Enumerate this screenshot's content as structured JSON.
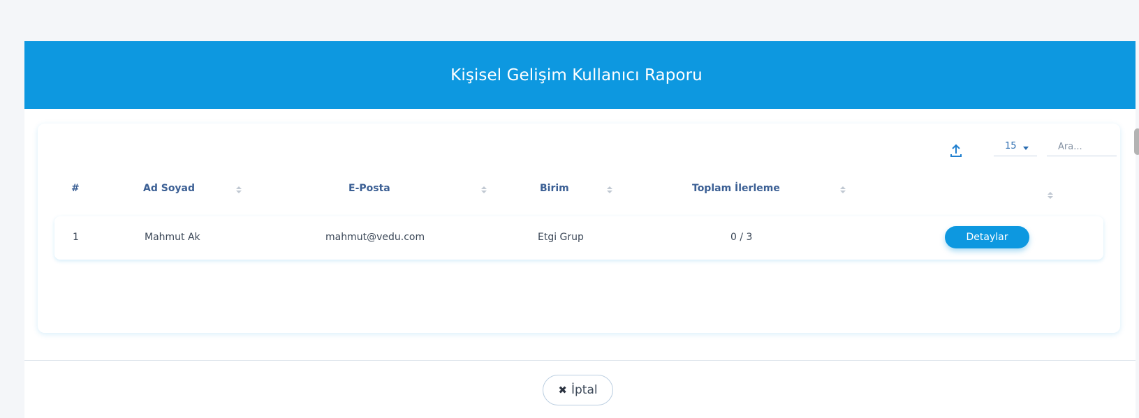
{
  "modal": {
    "title": "Kişisel Gelişim Kullanıcı Raporu",
    "cancel_label": "İptal",
    "cancel_icon": "x-icon"
  },
  "toolbar": {
    "export_icon": "upload-icon",
    "page_size": "15",
    "search_placeholder": "Ara..."
  },
  "table": {
    "headers": [
      "#",
      "Ad Soyad",
      "E-Posta",
      "Birim",
      "Toplam İlerleme",
      ""
    ],
    "rows": [
      {
        "index": "1",
        "name": "Mahmut Ak",
        "email": "mahmut@vedu.com",
        "unit": "Etgi Grup",
        "progress": "0 / 3",
        "action_label": "Detaylar"
      }
    ]
  },
  "colors": {
    "accent": "#0d98e0",
    "header_text": "#3b5f94"
  }
}
